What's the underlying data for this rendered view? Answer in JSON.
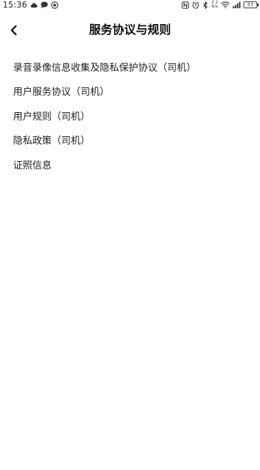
{
  "status_bar": {
    "time": "15:36",
    "net_speed_value": "2.1",
    "net_speed_unit": "K/s",
    "battery": "57",
    "left_icons": [
      "cloud-icon",
      "message-icon",
      "location-icon"
    ],
    "right_icons": [
      "nfc-icon",
      "alarm-icon",
      "bluetooth-icon",
      "wifi-icon",
      "signal-icon"
    ]
  },
  "header": {
    "title": "服务协议与规则",
    "back_icon": "chevron-left-icon"
  },
  "list": {
    "items": [
      {
        "label": "录音录像信息收集及隐私保护协议（司机）"
      },
      {
        "label": "用户服务协议（司机）"
      },
      {
        "label": "用户规则（司机）"
      },
      {
        "label": "隐私政策（司机）"
      },
      {
        "label": "证照信息"
      }
    ]
  }
}
